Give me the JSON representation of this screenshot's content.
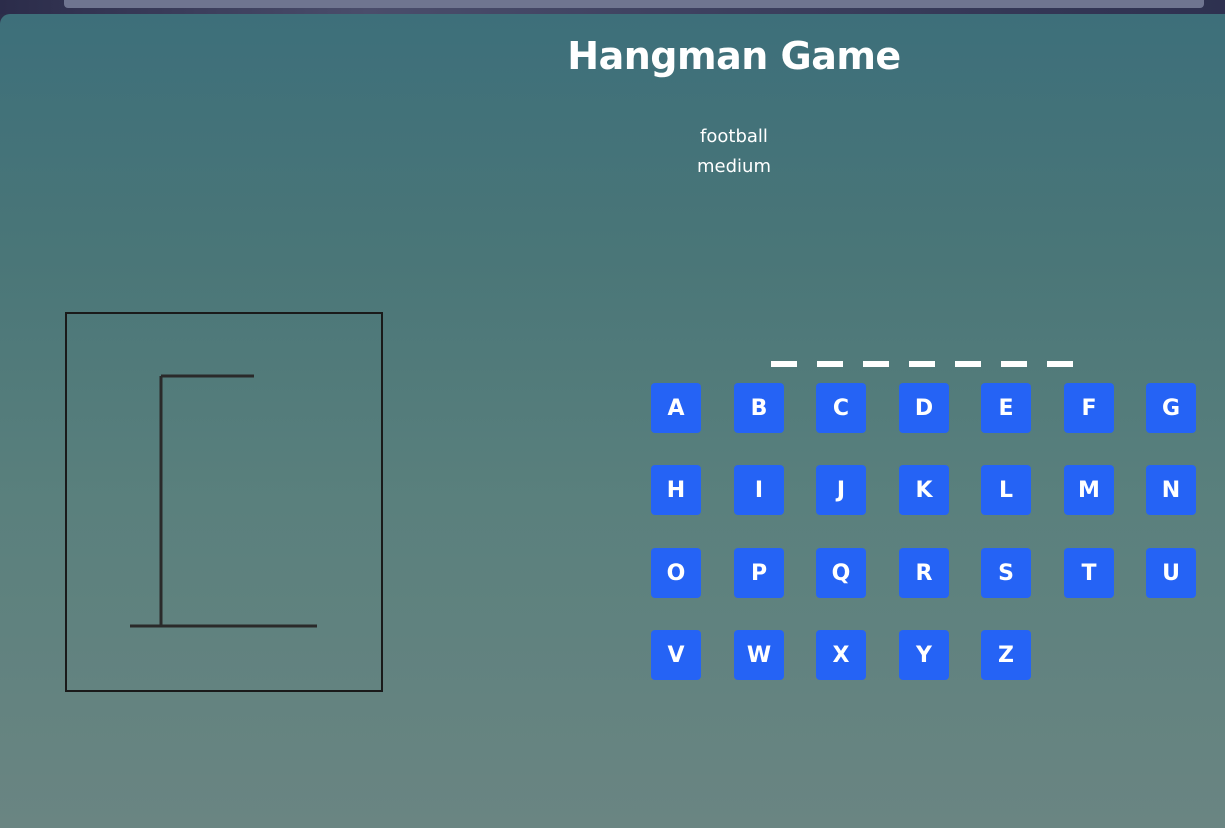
{
  "title": "Hangman Game",
  "category": "football",
  "difficulty": "medium",
  "word_slots": [
    "",
    "",
    "",
    "",
    "",
    "",
    ""
  ],
  "letters": [
    "A",
    "B",
    "C",
    "D",
    "E",
    "F",
    "G",
    "H",
    "I",
    "J",
    "K",
    "L",
    "M",
    "N",
    "O",
    "P",
    "Q",
    "R",
    "S",
    "T",
    "U",
    "V",
    "W",
    "X",
    "Y",
    "Z"
  ],
  "colors": {
    "key_bg": "#2563f5",
    "key_text": "#ffffff",
    "gallows": "#2a2a2a"
  },
  "hangman_stage": "gallows-only"
}
